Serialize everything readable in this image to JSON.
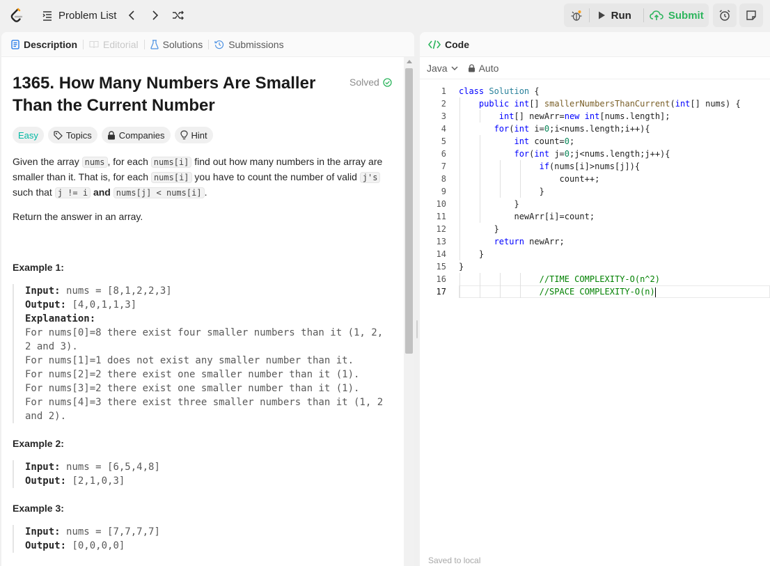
{
  "topbar": {
    "problem_list_label": "Problem List",
    "run_label": "Run",
    "submit_label": "Submit"
  },
  "colors": {
    "accent_green": "#2db55d",
    "easy": "#00b8a3",
    "brand_orange": "#ffa116"
  },
  "left_tabs": [
    {
      "label": "Description",
      "icon": "document-icon"
    },
    {
      "label": "Editorial",
      "icon": "book-icon"
    },
    {
      "label": "Solutions",
      "icon": "flask-icon"
    },
    {
      "label": "Submissions",
      "icon": "history-icon"
    }
  ],
  "problem": {
    "title": "1365. How Many Numbers Are Smaller Than the Current Number",
    "status": "Solved",
    "difficulty": "Easy",
    "chips": [
      "Topics",
      "Companies",
      "Hint"
    ],
    "p1_a": "Given the array ",
    "p1_code1": "nums",
    "p1_b": ", for each ",
    "p1_code2": "nums[i]",
    "p1_c": " find out how many numbers in the array are smaller than it. That is, for each ",
    "p1_code3": "nums[i]",
    "p1_d": " you have to count the number of valid ",
    "p1_code4": "j's",
    "p1_e": " such that ",
    "p1_code5": "j != i",
    "p1_and": "and",
    "p1_code6": "nums[j] < nums[i]",
    "p1_end": ".",
    "p2": "Return the answer in an array.",
    "examples": [
      {
        "heading": "Example 1:",
        "input_label": "Input:",
        "input": "nums = [8,1,2,2,3]",
        "output_label": "Output:",
        "output": "[4,0,1,1,3]",
        "explanation_label": "Explanation:",
        "explanation": "For nums[0]=8 there exist four smaller numbers than it (1, 2, 2 and 3). \nFor nums[1]=1 does not exist any smaller number than it.\nFor nums[2]=2 there exist one smaller number than it (1). \nFor nums[3]=2 there exist one smaller number than it (1). \nFor nums[4]=3 there exist three smaller numbers than it (1, 2 and 2)."
      },
      {
        "heading": "Example 2:",
        "input_label": "Input:",
        "input": "nums = [6,5,4,8]",
        "output_label": "Output:",
        "output": "[2,1,0,3]"
      },
      {
        "heading": "Example 3:",
        "input_label": "Input:",
        "input": "nums = [7,7,7,7]",
        "output_label": "Output:",
        "output": "[0,0,0,0]"
      }
    ]
  },
  "code_panel": {
    "tab_label": "Code",
    "language": "Java",
    "mode": "Auto",
    "saved_text": "Saved to local",
    "current_line": 17,
    "lines": [
      "class Solution {",
      "    public int[] smallerNumbersThanCurrent(int[] nums) {",
      "        int[] newArr=new int[nums.length];",
      "       for(int i=0;i<nums.length;i++){",
      "           int count=0;",
      "           for(int j=0;j<nums.length;j++){",
      "                if(nums[i]>nums[j]){",
      "                    count++;",
      "                }",
      "           }",
      "           newArr[i]=count;",
      "       }",
      "       return newArr;",
      "    }",
      "}",
      "                //TIME COMPLEXITY-O(n^2)",
      "                //SPACE COMPLEXITY-O(n)"
    ]
  }
}
